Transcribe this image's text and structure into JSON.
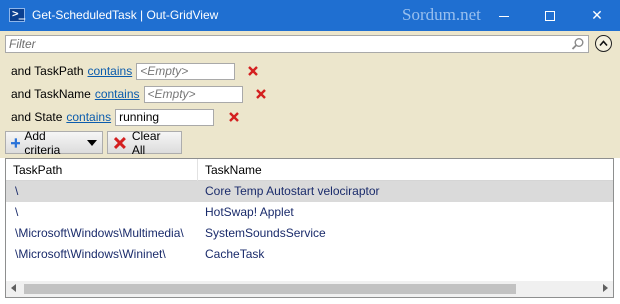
{
  "window": {
    "title": "Get-ScheduledTask | Out-GridView",
    "watermark": "Sordum.net"
  },
  "filter": {
    "placeholder": "Filter",
    "value": ""
  },
  "criteria": [
    {
      "prefix": "and TaskPath",
      "operator": "contains",
      "value": "",
      "placeholder": "<Empty>"
    },
    {
      "prefix": "and TaskName",
      "operator": "contains",
      "value": "",
      "placeholder": "<Empty>"
    },
    {
      "prefix": "and State",
      "operator": "contains",
      "value": "running",
      "placeholder": ""
    }
  ],
  "buttons": {
    "add_criteria": "Add criteria",
    "clear_all": "Clear All"
  },
  "grid": {
    "columns": [
      "TaskPath",
      "TaskName"
    ],
    "rows": [
      {
        "task_path": "\\",
        "task_name": "Core Temp Autostart velociraptor",
        "selected": true
      },
      {
        "task_path": "\\",
        "task_name": "HotSwap! Applet",
        "selected": false
      },
      {
        "task_path": "\\Microsoft\\Windows\\Multimedia\\",
        "task_name": "SystemSoundsService",
        "selected": false
      },
      {
        "task_path": "\\Microsoft\\Windows\\Wininet\\",
        "task_name": "CacheTask",
        "selected": false
      }
    ]
  },
  "colors": {
    "titlebar": "#1f6fd1",
    "panel": "#ece6cc",
    "link": "#0b5cad",
    "remove": "#d42020",
    "selected_row": "#dadada"
  }
}
